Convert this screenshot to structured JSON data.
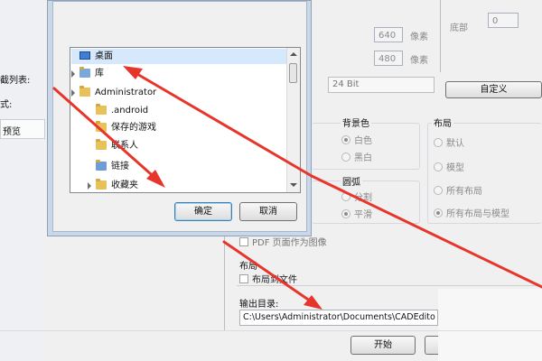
{
  "left_panel": {
    "labels": [
      "截列表:",
      "式:"
    ],
    "preview_label": "预览"
  },
  "top_right": {
    "bottom_label": "底部",
    "bottom_value": "0",
    "width_value": "640",
    "height_value": "480",
    "unit": "像素",
    "color_depth": "24 Bit",
    "custom_button": "自定义"
  },
  "background_group": {
    "title": "背景色",
    "options": [
      {
        "label": "白色",
        "selected": true
      },
      {
        "label": "黑白",
        "selected": false
      }
    ]
  },
  "arc_group": {
    "title": "圆弧",
    "options": [
      {
        "label": "分割",
        "selected": false
      },
      {
        "label": "平滑",
        "selected": true
      }
    ]
  },
  "layout_group": {
    "title": "布局",
    "options": [
      {
        "label": "默认",
        "selected": false
      },
      {
        "label": "模型",
        "selected": false
      },
      {
        "label": "所有布局",
        "selected": false
      },
      {
        "label": "所有布局与模型",
        "selected": true
      }
    ]
  },
  "pdf_option": "PDF 页面作为图像",
  "layout_section": {
    "title": "布局",
    "checkbox": "布局到文件"
  },
  "output": {
    "label": "输出目录:",
    "path": "C:\\Users\\Administrator\\Documents\\CADEdito"
  },
  "start_button": "开始",
  "folder_dialog": {
    "tree": [
      {
        "label": "桌面",
        "icon": "desktop-icon",
        "indent": 0,
        "selected": true,
        "expandable": false
      },
      {
        "label": "库",
        "icon": "library-icon",
        "indent": 0,
        "selected": false,
        "expandable": true
      },
      {
        "label": "Administrator",
        "icon": "user-folder-icon",
        "indent": 0,
        "selected": false,
        "expandable": true
      },
      {
        "label": ".android",
        "icon": "folder-icon",
        "indent": 1,
        "selected": false,
        "expandable": false
      },
      {
        "label": "保存的游戏",
        "icon": "folder-icon",
        "indent": 1,
        "selected": false,
        "expandable": false
      },
      {
        "label": "联系人",
        "icon": "contacts-icon",
        "indent": 1,
        "selected": false,
        "expandable": false
      },
      {
        "label": "链接",
        "icon": "links-icon",
        "indent": 1,
        "selected": false,
        "expandable": false
      },
      {
        "label": "收藏夹",
        "icon": "favorites-icon",
        "indent": 1,
        "selected": false,
        "expandable": true
      }
    ],
    "ok_button": "确定",
    "cancel_button": "取消"
  },
  "colors": {
    "annotation_arrow": "#e8352b",
    "selection": "#d6e8fb"
  }
}
